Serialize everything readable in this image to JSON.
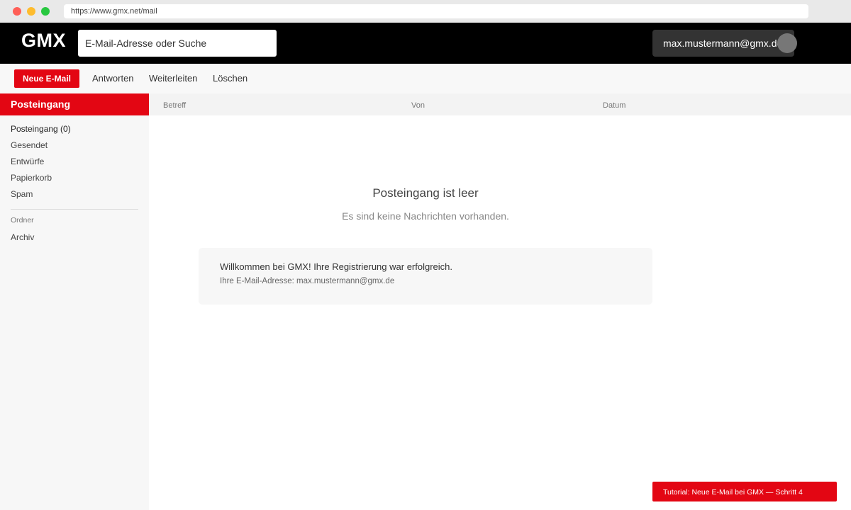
{
  "browser": {
    "url": "https://www.gmx.net/mail"
  },
  "header": {
    "logo": "GMX",
    "search_placeholder": "E-Mail-Adresse oder Suche",
    "account_email": "max.mustermann@gmx.de"
  },
  "toolbar": {
    "new_label": "Neue E-Mail",
    "reply_label": "Antworten",
    "forward_label": "Weiterleiten",
    "delete_label": "Löschen"
  },
  "sidebar": {
    "header": "Posteingang",
    "items": [
      {
        "label": "Posteingang (0)"
      },
      {
        "label": "Gesendet"
      },
      {
        "label": "Entwürfe"
      },
      {
        "label": "Papierkorb"
      },
      {
        "label": "Spam"
      }
    ],
    "section_title": "Ordner",
    "folders": [
      {
        "label": "Archiv"
      }
    ]
  },
  "list": {
    "columns": [
      "Betreff",
      "Von",
      "Datum"
    ]
  },
  "empty": {
    "title": "Posteingang ist leer",
    "subtitle": "Es sind keine Nachrichten vorhanden."
  },
  "welcome": {
    "title": "Willkommen bei GMX! Ihre Registrierung war erfolgreich.",
    "subtitle": "Ihre E-Mail-Adresse: max.mustermann@gmx.de"
  },
  "tutorial": {
    "text": "Tutorial: Neue E-Mail bei GMX — Schritt 4"
  },
  "colors": {
    "brand_red": "#e30613",
    "header_bg": "#000000"
  }
}
